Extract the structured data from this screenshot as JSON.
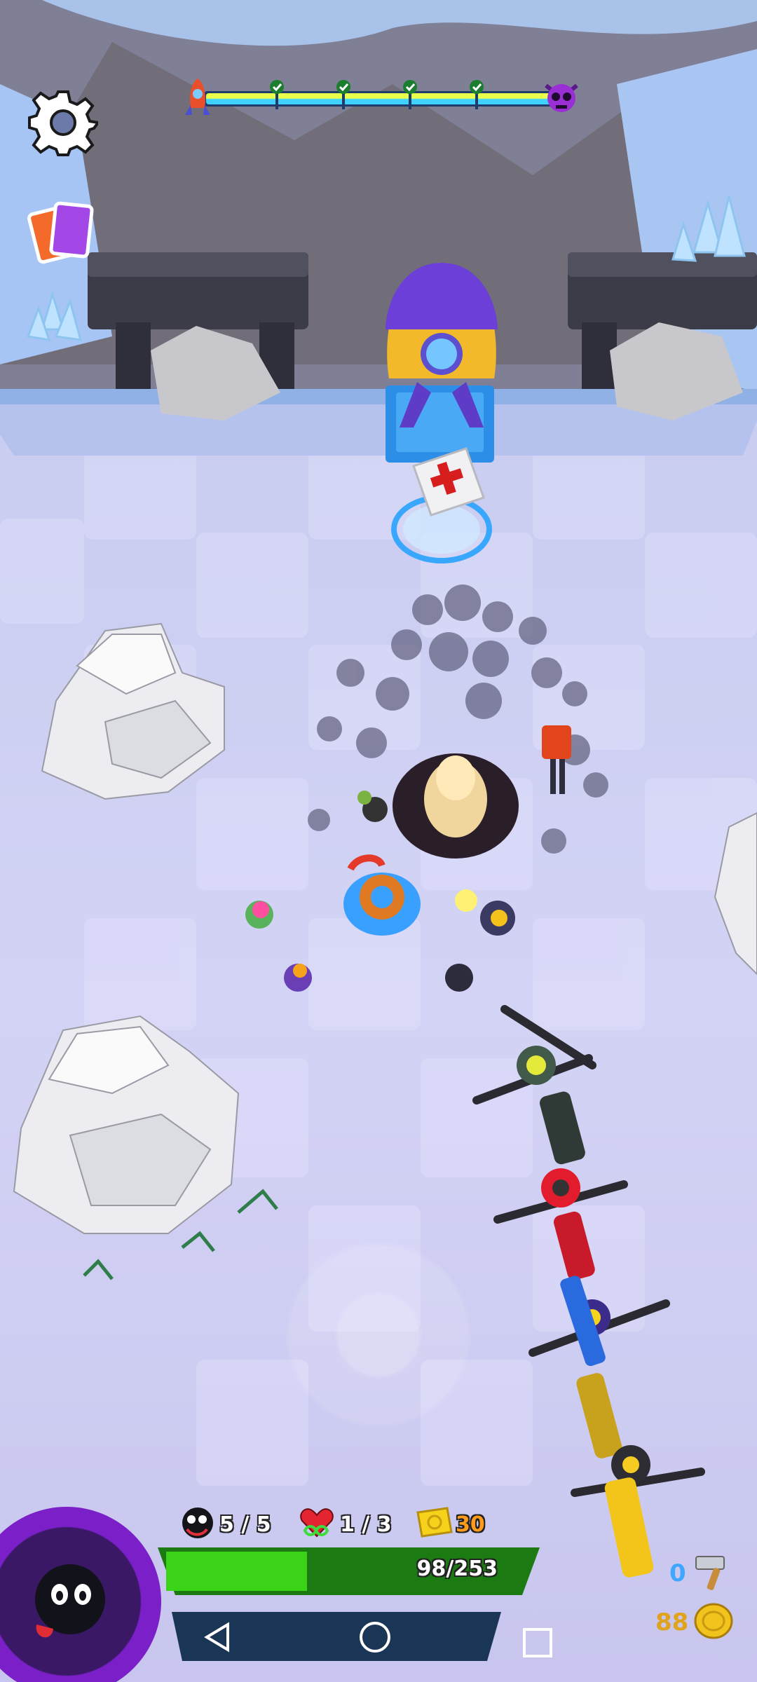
{
  "hud": {
    "level_progress": {
      "checkpoints_completed": 5,
      "checkpoints_total": 5
    },
    "minions": {
      "icon": "minion-face-icon",
      "value": "5 / 5"
    },
    "lives": {
      "icon": "heart-infinity-icon",
      "value": "1 / 3"
    },
    "tickets": {
      "icon": "ticket-icon",
      "value": "30"
    },
    "health": {
      "value": "98/253",
      "fraction": 0.387
    },
    "hammer": {
      "icon": "hammer-icon",
      "value": "0"
    },
    "coins": {
      "icon": "coin-icon",
      "value": "88"
    }
  },
  "buttons": {
    "settings": "gear-icon",
    "cards": "cards-icon",
    "ability": "ability-orb"
  },
  "navbar": {
    "back": "back-icon",
    "home": "home-icon",
    "recents": "recents-icon"
  },
  "colors": {
    "accent_yellow": "#f6e33a",
    "health_green": "#3bd318",
    "ability_purple": "#7b20c9",
    "boss_purple": "#9a2fd6"
  }
}
